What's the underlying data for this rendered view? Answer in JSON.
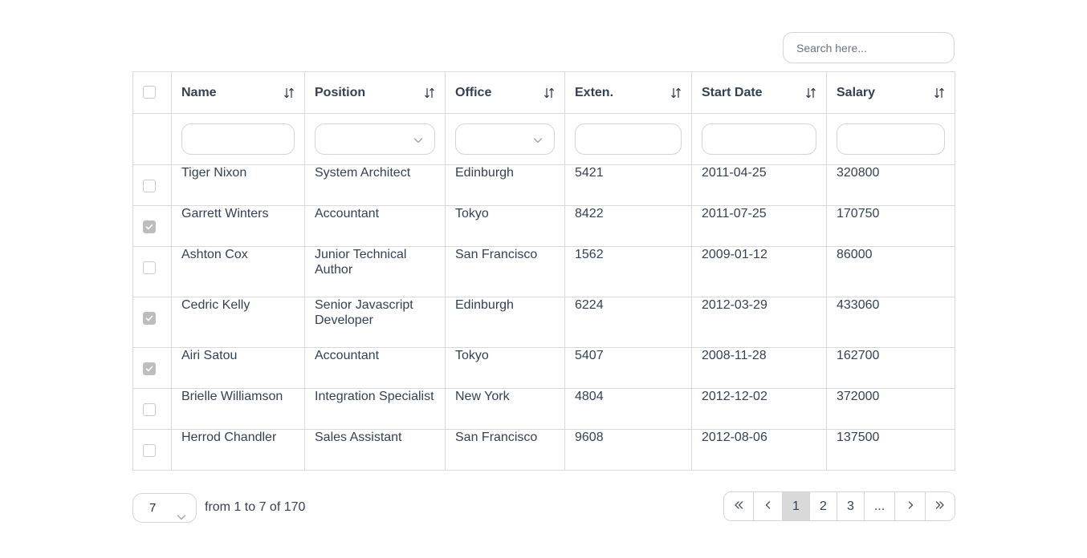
{
  "search": {
    "placeholder": "Search here..."
  },
  "columns": [
    {
      "label": "Name",
      "filter": "input"
    },
    {
      "label": "Position",
      "filter": "select"
    },
    {
      "label": "Office",
      "filter": "select"
    },
    {
      "label": "Exten.",
      "filter": "input"
    },
    {
      "label": "Start Date",
      "filter": "input"
    },
    {
      "label": "Salary",
      "filter": "input"
    }
  ],
  "rows": [
    {
      "checked": false,
      "name": "Tiger Nixon",
      "position": "System Architect",
      "office": "Edinburgh",
      "ext": "5421",
      "start": "2011-04-25",
      "salary": "320800"
    },
    {
      "checked": true,
      "name": "Garrett Winters",
      "position": "Accountant",
      "office": "Tokyo",
      "ext": "8422",
      "start": "2011-07-25",
      "salary": "170750"
    },
    {
      "checked": false,
      "name": "Ashton Cox",
      "position": "Junior Technical Author",
      "office": "San Francisco",
      "ext": "1562",
      "start": "2009-01-12",
      "salary": "86000"
    },
    {
      "checked": true,
      "name": "Cedric Kelly",
      "position": "Senior Javascript Developer",
      "office": "Edinburgh",
      "ext": "6224",
      "start": "2012-03-29",
      "salary": "433060"
    },
    {
      "checked": true,
      "name": "Airi Satou",
      "position": "Accountant",
      "office": "Tokyo",
      "ext": "5407",
      "start": "2008-11-28",
      "salary": "162700"
    },
    {
      "checked": false,
      "name": "Brielle Williamson",
      "position": "Integration Specialist",
      "office": "New York",
      "ext": "4804",
      "start": "2012-12-02",
      "salary": "372000"
    },
    {
      "checked": false,
      "name": "Herrod Chandler",
      "position": "Sales Assistant",
      "office": "San Francisco",
      "ext": "9608",
      "start": "2012-08-06",
      "salary": "137500"
    }
  ],
  "pagination": {
    "per_page": "7",
    "range_text": "from 1 to 7 of 170",
    "pages": [
      {
        "label": "«",
        "icon": "double-chevron-left-icon",
        "kind": "first"
      },
      {
        "label": "‹",
        "icon": "chevron-left-icon",
        "kind": "prev"
      },
      {
        "label": "1",
        "kind": "page",
        "active": true
      },
      {
        "label": "2",
        "kind": "page"
      },
      {
        "label": "3",
        "kind": "page"
      },
      {
        "label": "...",
        "kind": "ellipsis"
      },
      {
        "label": "›",
        "icon": "chevron-right-icon",
        "kind": "next"
      },
      {
        "label": "»",
        "icon": "double-chevron-right-icon",
        "kind": "last"
      }
    ]
  },
  "colors": {
    "border": "#d9d9d9",
    "text": "#334155",
    "active_page": "#d9d9d9",
    "checkbox_checked": "#bdbdbd"
  }
}
